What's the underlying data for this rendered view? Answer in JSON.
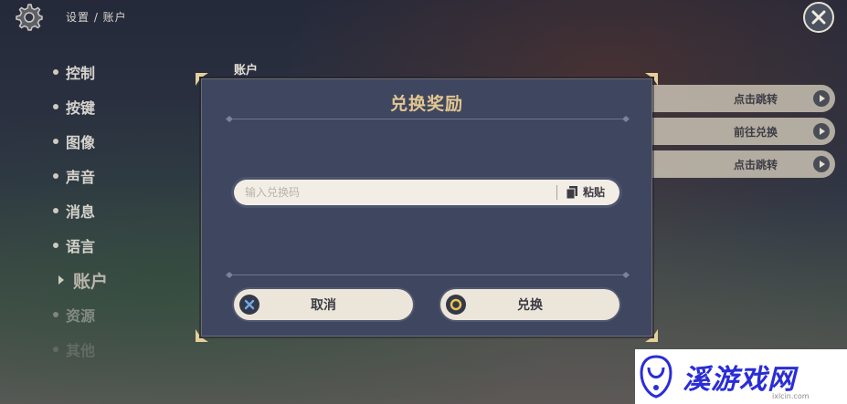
{
  "breadcrumb": "设置 / 账户",
  "nav": {
    "items": [
      {
        "label": "控制"
      },
      {
        "label": "按键"
      },
      {
        "label": "图像"
      },
      {
        "label": "声音"
      },
      {
        "label": "消息"
      },
      {
        "label": "语言"
      },
      {
        "label": "账户"
      },
      {
        "label": "资源"
      },
      {
        "label": "其他"
      }
    ]
  },
  "section_label": "账户",
  "side_buttons": [
    {
      "label": "点击跳转"
    },
    {
      "label": "前往兑换"
    },
    {
      "label": "点击跳转"
    }
  ],
  "dialog": {
    "title": "兑换奖励",
    "input_placeholder": "输入兑换码",
    "input_value": "",
    "paste_label": "粘贴",
    "cancel_label": "取消",
    "confirm_label": "兑换"
  },
  "watermark": {
    "text": "溪游戏网",
    "url": "ixlcin.com"
  },
  "colors": {
    "dialog_bg": "#3f4660",
    "title_gold": "#e3c68f",
    "button_bg": "#ece6da"
  }
}
